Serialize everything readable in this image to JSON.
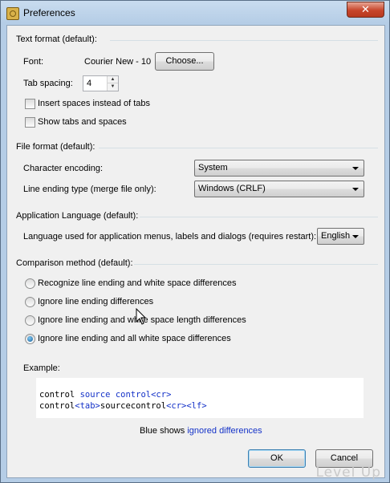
{
  "window": {
    "title": "Preferences",
    "close_label": "✕"
  },
  "text_format": {
    "group_title": "Text format (default):",
    "font_label": "Font:",
    "font_value": "Courier New - 10",
    "choose_button": "Choose...",
    "tab_spacing_label": "Tab spacing:",
    "tab_spacing_value": "4",
    "insert_spaces_label": "Insert spaces instead of tabs",
    "insert_spaces_checked": false,
    "show_tabs_label": "Show tabs and spaces",
    "show_tabs_checked": false
  },
  "file_format": {
    "group_title": "File format (default):",
    "encoding_label": "Character encoding:",
    "encoding_value": "System",
    "line_ending_label": "Line ending type (merge file only):",
    "line_ending_value": "Windows (CRLF)"
  },
  "app_language": {
    "group_title": "Application Language (default):",
    "language_label": "Language used for application menus, labels and dialogs (requires restart):",
    "language_value": "English"
  },
  "comparison": {
    "group_title": "Comparison method (default):",
    "options": [
      {
        "label": "Recognize line ending and white space differences",
        "selected": false
      },
      {
        "label": "Ignore line ending differences",
        "selected": false
      },
      {
        "label": "Ignore line ending and white space length differences",
        "selected": false
      },
      {
        "label": "Ignore line ending and all white space differences",
        "selected": true
      }
    ]
  },
  "example": {
    "label": "Example:",
    "line1": {
      "a": "control ",
      "b": "source",
      "c": " ",
      "d": "control",
      "e": "<cr>"
    },
    "line2": {
      "a": "control",
      "b": "<tab>",
      "c": "sourcecontrol",
      "d": "<cr><lf>"
    },
    "legend_prefix": "Blue shows ",
    "legend_highlight": "ignored differences"
  },
  "buttons": {
    "ok": "OK",
    "cancel": "Cancel"
  },
  "watermark": "Level Up",
  "colors": {
    "ignored": "#1432c8"
  }
}
